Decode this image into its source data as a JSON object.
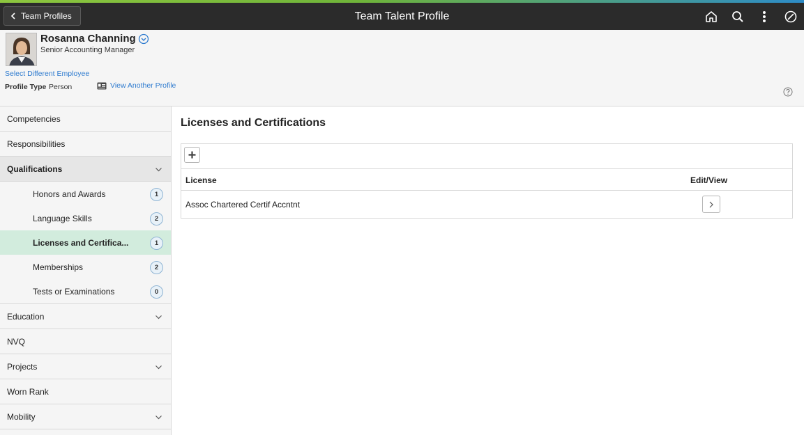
{
  "header": {
    "back_label": "Team Profiles",
    "title": "Team Talent Profile",
    "icons": [
      "home-icon",
      "search-icon",
      "actions-menu-icon",
      "navbar-icon"
    ]
  },
  "employee": {
    "name": "Rosanna Channing",
    "job_title": "Senior Accounting Manager",
    "select_different_label": "Select Different Employee",
    "profile_type_label": "Profile Type",
    "profile_type_value": "Person",
    "view_another_label": "View Another Profile"
  },
  "sidebar": {
    "items": [
      {
        "label": "Competencies"
      },
      {
        "label": "Responsibilities"
      },
      {
        "label": "Qualifications",
        "expanded": true
      },
      {
        "label": "Education",
        "expandable": true
      },
      {
        "label": "NVQ"
      },
      {
        "label": "Projects",
        "expandable": true
      },
      {
        "label": "Worn Rank"
      },
      {
        "label": "Mobility",
        "expandable": true
      }
    ],
    "qualifications_sub": [
      {
        "label": "Honors and Awards",
        "count": "1"
      },
      {
        "label": "Language Skills",
        "count": "2"
      },
      {
        "label": "Licenses and Certifica...",
        "count": "1",
        "active": true
      },
      {
        "label": "Memberships",
        "count": "2"
      },
      {
        "label": "Tests or Examinations",
        "count": "0"
      }
    ]
  },
  "main": {
    "section_title": "Licenses and Certifications",
    "columns": {
      "license": "License",
      "edit_view": "Edit/View"
    },
    "rows": [
      {
        "license": "Assoc Chartered Certif Accntnt"
      }
    ]
  },
  "colors": {
    "header_bg": "#2b2b2b",
    "accent_green": "#78b34a",
    "active_nav_bg": "#d2ecdd",
    "link_blue": "#2e7bcf"
  }
}
